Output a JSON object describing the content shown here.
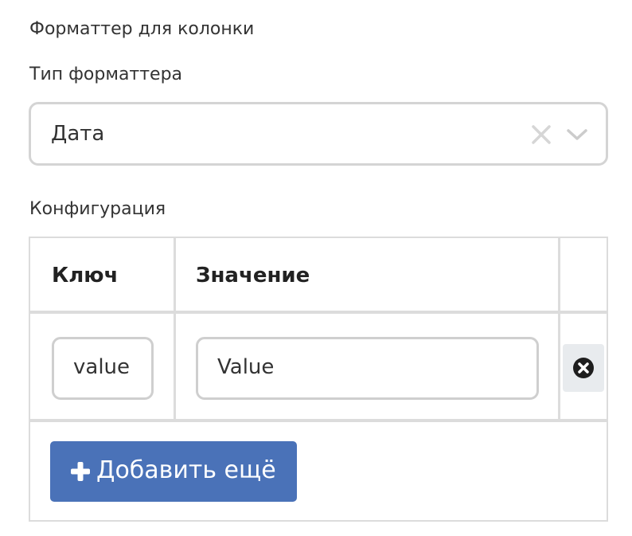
{
  "section": {
    "title": "Форматтер для колонки"
  },
  "formatter_type": {
    "label": "Тип форматтера",
    "selected": "Дата",
    "clear_icon": "x-icon",
    "dropdown_icon": "chevron-down-icon"
  },
  "configuration": {
    "label": "Конфигурация",
    "columns": {
      "key": "Ключ",
      "value": "Значение"
    },
    "rows": [
      {
        "key": "value",
        "value": "Value",
        "remove_icon": "times-circle-icon"
      }
    ],
    "add_button": {
      "icon": "plus-icon",
      "label": "Добавить ещё"
    }
  },
  "colors": {
    "primary_button": "#4a72b8",
    "border": "#d4d4d4",
    "text": "#333333"
  }
}
